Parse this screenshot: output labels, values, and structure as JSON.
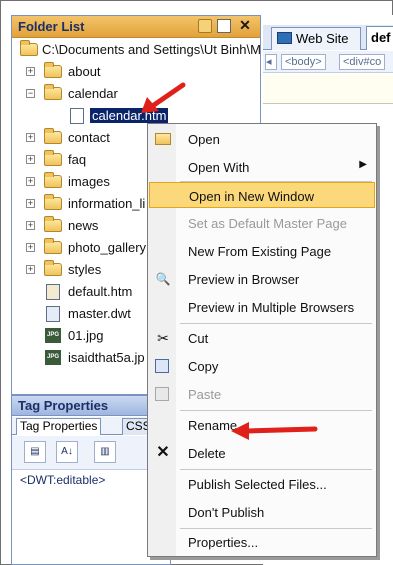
{
  "folder_list": {
    "title": "Folder List",
    "root_path": "C:\\Documents and Settings\\Ut Binh\\M",
    "items": [
      {
        "label": "about",
        "type": "folder",
        "expander": "+"
      },
      {
        "label": "calendar",
        "type": "folder",
        "expander": "−"
      },
      {
        "label": "calendar.htm",
        "type": "page"
      },
      {
        "label": "contact",
        "type": "folder",
        "expander": "+"
      },
      {
        "label": "faq",
        "type": "folder",
        "expander": "+"
      },
      {
        "label": "images",
        "type": "folder",
        "expander": "+"
      },
      {
        "label": "information_li",
        "type": "folder",
        "expander": "+"
      },
      {
        "label": "news",
        "type": "folder",
        "expander": "+"
      },
      {
        "label": "photo_gallery",
        "type": "folder",
        "expander": "+"
      },
      {
        "label": "styles",
        "type": "folder",
        "expander": "+"
      },
      {
        "label": "default.htm",
        "type": "page"
      },
      {
        "label": "master.dwt",
        "type": "template"
      },
      {
        "label": "01.jpg",
        "type": "jpg"
      },
      {
        "label": "isaidthat5a.jp",
        "type": "jpg"
      }
    ],
    "close_glyph": "✕",
    "jpg_badge": "JPG"
  },
  "tag_properties": {
    "title": "Tag Properties",
    "tabs": [
      "Tag Properties",
      "CSS"
    ],
    "toolbar_glyphs": [
      "▤",
      "A↓",
      "▥"
    ],
    "tag_label": "<DWT:editable>"
  },
  "site": {
    "tabs": [
      "Web Site",
      "def"
    ],
    "breadcrumbs": [
      "<body>",
      "<div#co"
    ],
    "scroll_left": "◂"
  },
  "context_menu": {
    "items": [
      {
        "label": "Open",
        "icon": "open-icon"
      },
      {
        "label": "Open With",
        "submenu": true
      },
      {
        "label": "Open in New Window",
        "highlighted": true
      },
      {
        "label": "Set as Default Master Page",
        "disabled": true
      },
      {
        "label": "New From Existing Page"
      },
      {
        "label": "Preview in Browser",
        "icon": "preview-icon"
      },
      {
        "label": "Preview in Multiple Browsers"
      },
      {
        "label": "Cut",
        "icon": "scissors-icon"
      },
      {
        "label": "Copy",
        "icon": "copy-icon"
      },
      {
        "label": "Paste",
        "icon": "paste-icon",
        "disabled": true
      },
      {
        "label": "Rename"
      },
      {
        "label": "Delete",
        "icon": "delete-x-icon"
      },
      {
        "label": "Publish Selected Files..."
      },
      {
        "label": "Don't Publish"
      },
      {
        "label": "Properties..."
      }
    ],
    "submenu_glyph": "▶",
    "icon_glyphs": {
      "scissors": "✂",
      "delete": "✕",
      "preview": "🔍"
    }
  },
  "colors": {
    "highlight": "#fbd97a",
    "selection": "#0a246a",
    "annotation_arrow": "#e0201a"
  }
}
